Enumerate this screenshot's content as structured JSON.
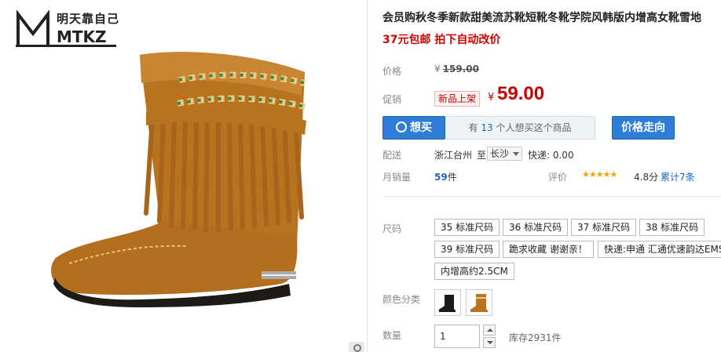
{
  "brand": {
    "logo_cn": "明天靠自己",
    "logo_en": "MTKZ"
  },
  "product": {
    "title": "会员购秋冬季新款甜美流苏靴短靴冬靴学院风韩版内增高女靴雪地",
    "subtitle": "37元包邮 拍下自动改价"
  },
  "price": {
    "label": "价格",
    "currency": "¥",
    "original": "159.00"
  },
  "promo": {
    "label": "促销",
    "badge": "新品上架",
    "currency": "¥",
    "price": "59.00"
  },
  "want": {
    "button_label": "想买",
    "count_prefix": "有",
    "count": "13",
    "count_suffix": "个人想买这个商品",
    "trend_label": "价格走向"
  },
  "shipping": {
    "label": "配送",
    "from": "浙江台州",
    "to_label": "至",
    "to_city": "长沙",
    "fee": "快递: 0.00"
  },
  "sales": {
    "label": "月销量",
    "count": "59",
    "unit": "件",
    "rating_label": "评价",
    "stars": "★★★★★",
    "score": "4.8分",
    "reviews": "累计7条"
  },
  "size": {
    "label": "尺码",
    "options": [
      "35 标准尺码",
      "36 标准尺码",
      "37 标准尺码",
      "38 标准尺码",
      "39 标准尺码",
      "跪求收藏 谢谢亲！",
      "快递:申通 汇通优速韵达EMS",
      "内增高约2.5CM"
    ]
  },
  "color": {
    "label": "颜色分类",
    "options": [
      "black-boot",
      "tan-boot"
    ]
  },
  "quantity": {
    "label": "数量",
    "value": "1",
    "stock": "库存2931件"
  },
  "colors": {
    "accent": "#2e7ed8",
    "price_red": "#c40000",
    "link_blue": "#2266bb",
    "star": "#f0a800"
  }
}
